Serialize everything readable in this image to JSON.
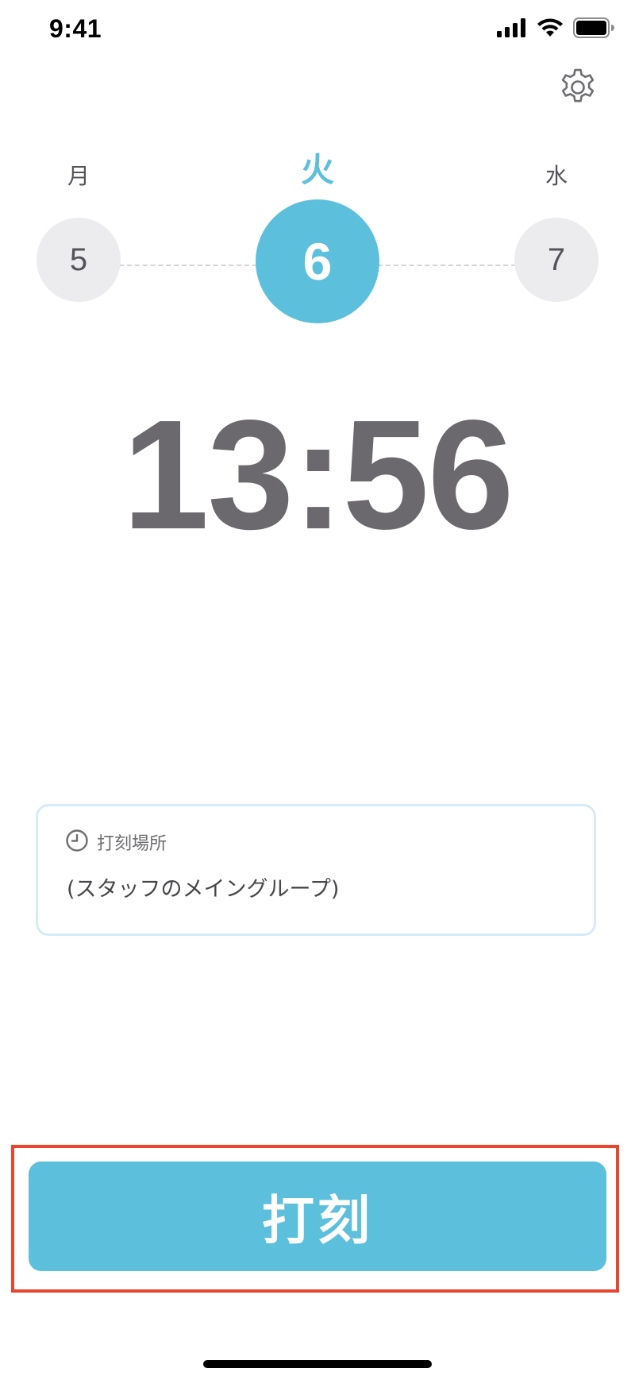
{
  "status_bar": {
    "time": "9:41",
    "icons": [
      "cellular-signal-icon",
      "wifi-icon",
      "battery-icon"
    ]
  },
  "header": {
    "settings_icon": "gear-icon"
  },
  "days": [
    {
      "weekday": "月",
      "date": "5",
      "active": false
    },
    {
      "weekday": "火",
      "date": "6",
      "active": true
    },
    {
      "weekday": "水",
      "date": "7",
      "active": false
    }
  ],
  "clock": {
    "time": "13:56"
  },
  "location": {
    "icon": "clock-icon",
    "title": "打刻場所",
    "value": "(スタッフのメイングループ)"
  },
  "punch": {
    "label": "打刻"
  },
  "colors": {
    "accent": "#5cbfdc",
    "inactive_circle": "#ececee",
    "text": "#55535a",
    "clock_text": "#6b696e",
    "card_border": "#d3ecf5",
    "highlight_frame": "#e8462f"
  }
}
